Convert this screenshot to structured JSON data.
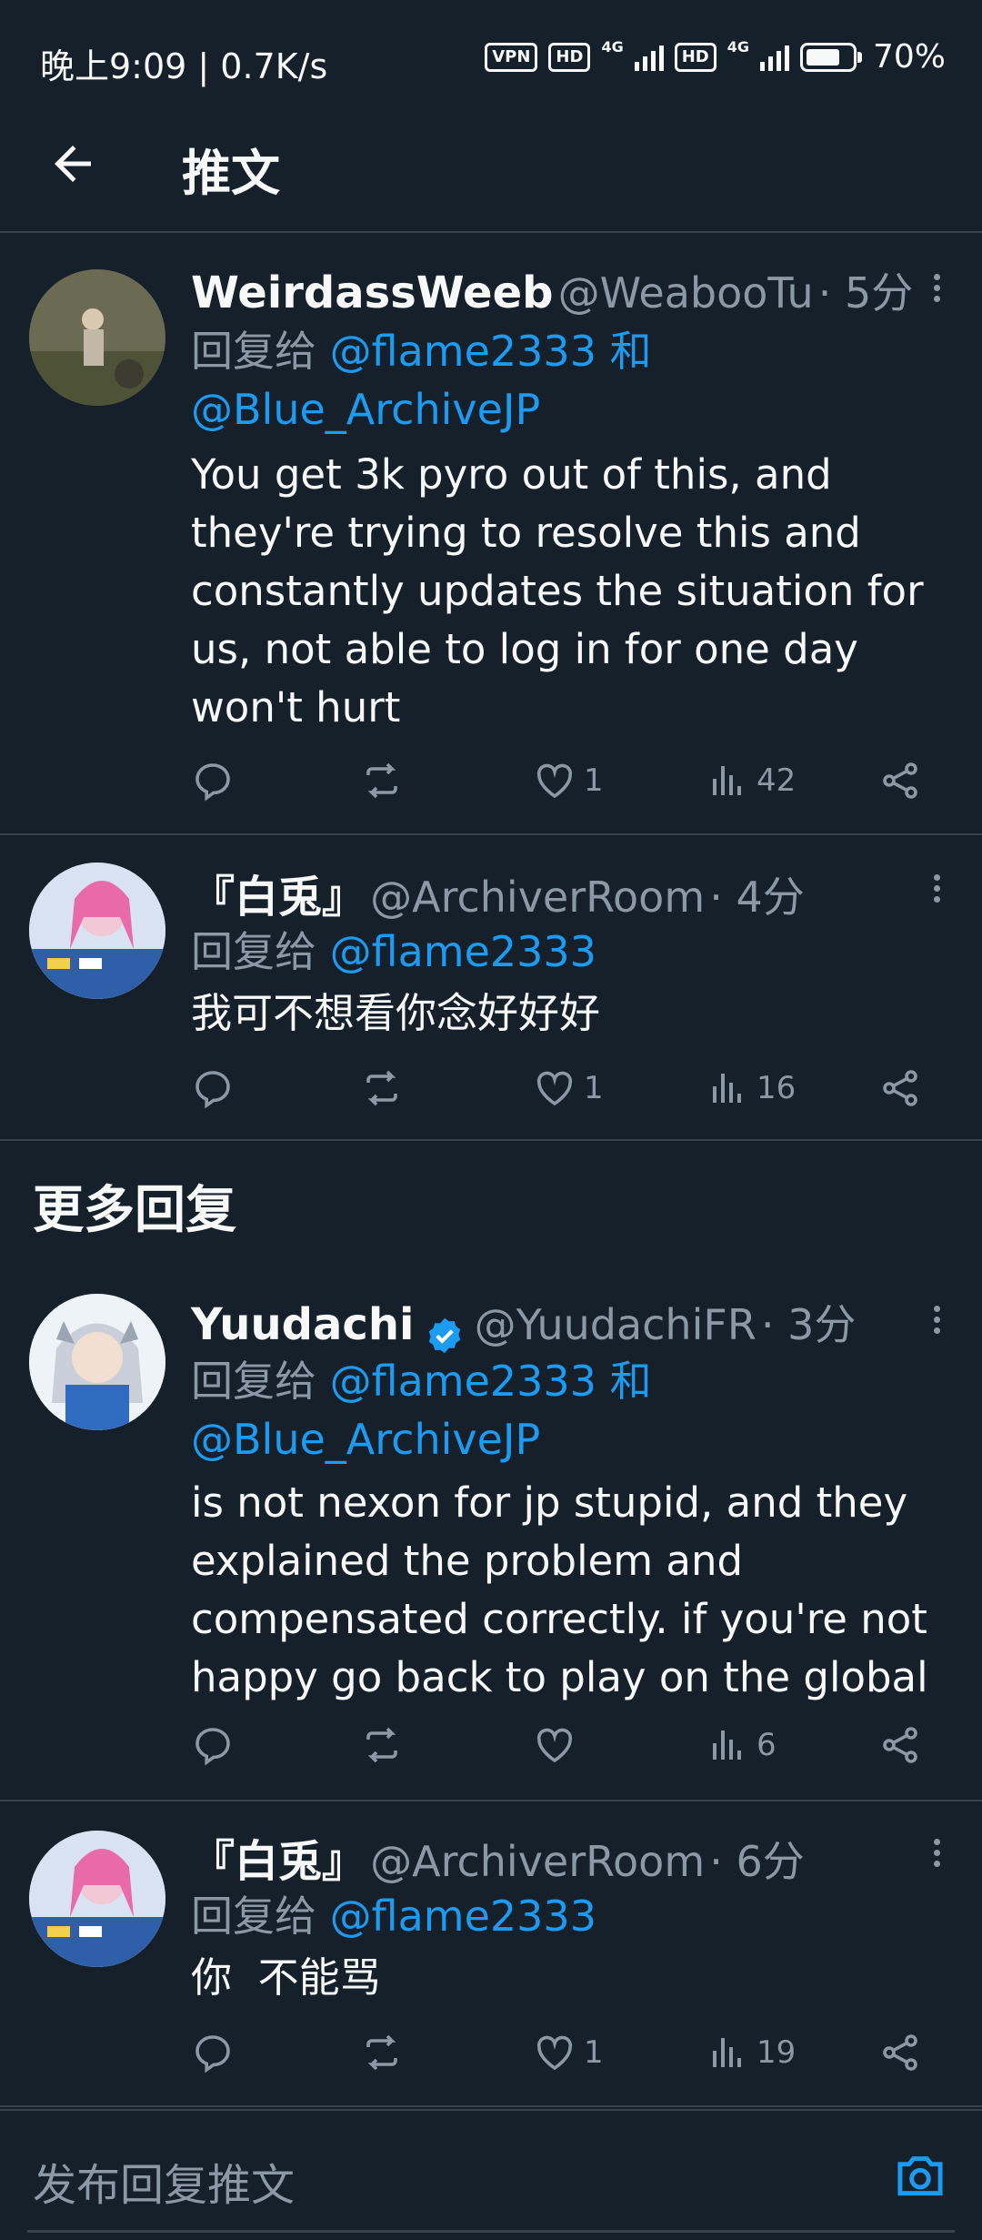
{
  "status": {
    "time_speed": "晚上9:09 | 0.7K/s",
    "vpn": "VPN",
    "hd1": "HD",
    "net1": "4G",
    "hd2": "HD",
    "net2": "4G",
    "battery": "70%"
  },
  "header": {
    "title": "推文"
  },
  "tweets": [
    {
      "name": "WeirdassWeeb",
      "handle": "@WeabooTu",
      "time": "· 5分",
      "reply_prefix": "回复给",
      "mention1": "@flame2333",
      "conj": "和",
      "mention2": "@Blue_ArchiveJP",
      "text": "You get 3k pyro out of this, and they're trying to resolve this and constantly updates the situation for us, not able to log in for one day won't hurt",
      "likes": "1",
      "views": "42"
    },
    {
      "name": "『白兎』",
      "handle": "@ArchiverRoom",
      "time": "· 4分",
      "reply_prefix": "回复给",
      "mention1": "@flame2333",
      "text": "我可不想看你念好好好",
      "likes": "1",
      "views": "16"
    },
    {
      "name": "Yuudachi",
      "handle": "@YuudachiFR",
      "time": "· 3分",
      "reply_prefix": "回复给",
      "mention1": "@flame2333",
      "conj": "和",
      "mention2": "@Blue_ArchiveJP",
      "text": "is not nexon for jp stupid, and they explained the problem and compensated correctly. if you're not happy go back to play on the global",
      "likes": "",
      "views": "6"
    },
    {
      "name": "『白兎』",
      "handle": "@ArchiverRoom",
      "time": "· 6分",
      "reply_prefix": "回复给",
      "mention1": "@flame2333",
      "text": "你  不能骂",
      "likes": "1",
      "views": "19"
    }
  ],
  "section_more": "更多回复",
  "composer": {
    "placeholder": "发布回复推文"
  },
  "colors": {
    "bg": "#15202b",
    "accent": "#1d9bf0",
    "muted": "#8b98a5",
    "divider": "#38444d"
  }
}
